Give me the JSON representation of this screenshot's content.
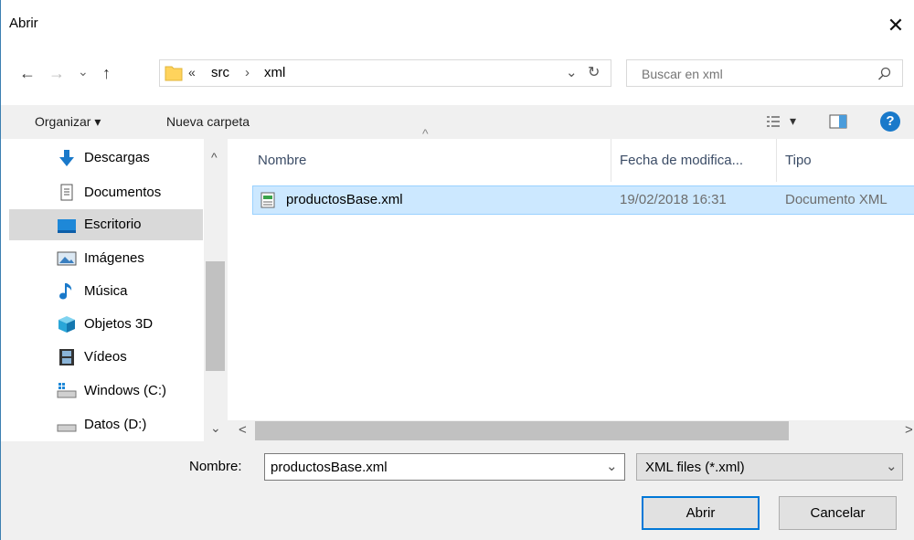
{
  "window": {
    "title": "Abrir",
    "close_glyph": "✕"
  },
  "nav": {
    "back": "←",
    "forward": "→",
    "recent": "⌄",
    "up": "↑"
  },
  "address": {
    "overflow": "«",
    "crumbs": [
      "src",
      "xml"
    ],
    "separator": "›",
    "dropdown_glyph": "⌄",
    "refresh_glyph": "↻"
  },
  "search": {
    "placeholder": "Buscar en xml",
    "icon": "search-icon"
  },
  "toolbar": {
    "organize_label": "Organizar ▾",
    "new_folder_label": "Nueva carpeta",
    "view_arrow": "▾",
    "help_glyph": "?"
  },
  "sidebar": {
    "items": [
      {
        "label": "Descargas",
        "icon": "download-icon"
      },
      {
        "label": "Documentos",
        "icon": "documents-icon"
      },
      {
        "label": "Escritorio",
        "icon": "desktop-icon",
        "selected": true
      },
      {
        "label": "Imágenes",
        "icon": "pictures-icon"
      },
      {
        "label": "Música",
        "icon": "music-icon"
      },
      {
        "label": "Objetos 3D",
        "icon": "objects3d-icon"
      },
      {
        "label": "Vídeos",
        "icon": "videos-icon"
      },
      {
        "label": "Windows (C:)",
        "icon": "drive-c-icon"
      },
      {
        "label": "Datos (D:)",
        "icon": "drive-d-icon"
      }
    ],
    "scroll_up": "^",
    "scroll_down": "⌄"
  },
  "list": {
    "columns": {
      "name": "Nombre",
      "date": "Fecha de modifica...",
      "type": "Tipo",
      "sort_indicator": "^"
    },
    "rows": [
      {
        "name": "productosBase.xml",
        "date": "19/02/2018 16:31",
        "type": "Documento XML"
      }
    ],
    "scroll_left": "<",
    "scroll_right": ">"
  },
  "footer": {
    "filename_label": "Nombre:",
    "filename_value": "productosBase.xml",
    "filename_dropdown": "⌄",
    "filetype_value": "XML files (*.xml)",
    "filetype_dropdown": "⌄",
    "open_label": "Abrir",
    "cancel_label": "Cancelar"
  },
  "colors": {
    "selection": "#cce8ff",
    "accent": "#0078d7",
    "folder": "#ffd35c",
    "header_text": "#3b4c66"
  }
}
